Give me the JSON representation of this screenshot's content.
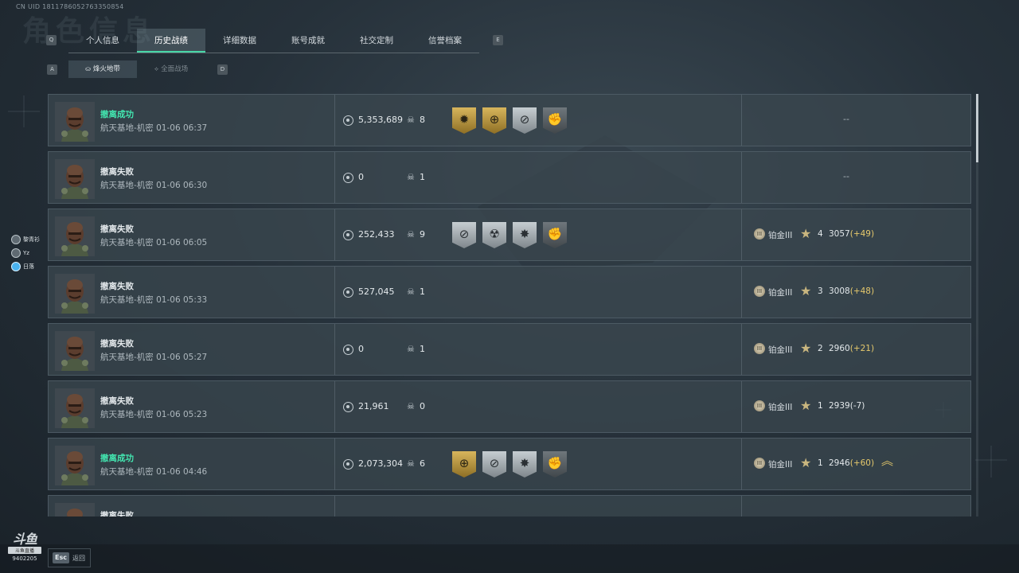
{
  "uid": "CN UID 1811786052763350854",
  "bg_title": "角色信息",
  "tab_keys": {
    "left": "Q",
    "right": "E"
  },
  "subtab_keys": {
    "left": "A",
    "right": "D"
  },
  "tabs": [
    {
      "label": "个人信息"
    },
    {
      "label": "历史战绩"
    },
    {
      "label": "详细数据"
    },
    {
      "label": "账号成就"
    },
    {
      "label": "社交定制"
    },
    {
      "label": "信誉档案"
    }
  ],
  "subtabs": [
    {
      "label": "烽火地带",
      "glyph": "⛀"
    },
    {
      "label": "全面战场",
      "glyph": "⟡"
    }
  ],
  "rows": [
    {
      "status": "撤离成功",
      "success": true,
      "map": "航天基地-机密 01-06 06:37",
      "value": "5,353,689",
      "kills": "8",
      "badges": [
        {
          "type": "gold",
          "glyph": "✹"
        },
        {
          "type": "gold",
          "glyph": "⊕"
        },
        {
          "type": "silver",
          "glyph": "⊘"
        },
        {
          "type": "dark",
          "glyph": "✊"
        }
      ],
      "rank": null,
      "dash": "--"
    },
    {
      "status": "撤离失败",
      "success": false,
      "map": "航天基地-机密 01-06 06:30",
      "value": "0",
      "kills": "1",
      "badges": [],
      "rank": null,
      "dash": "--"
    },
    {
      "status": "撤离失败",
      "success": false,
      "map": "航天基地-机密 01-06 06:05",
      "value": "252,433",
      "kills": "9",
      "badges": [
        {
          "type": "silver",
          "glyph": "⊘"
        },
        {
          "type": "silver",
          "glyph": "☢"
        },
        {
          "type": "silver",
          "glyph": "✸"
        },
        {
          "type": "dark",
          "glyph": "✊"
        }
      ],
      "rank": {
        "tier": "铂金III",
        "icon": "III",
        "stars": "4",
        "score": "3057",
        "delta": "(+49)",
        "promo": false
      }
    },
    {
      "status": "撤离失败",
      "success": false,
      "map": "航天基地-机密 01-06 05:33",
      "value": "527,045",
      "kills": "1",
      "badges": [],
      "rank": {
        "tier": "铂金III",
        "icon": "III",
        "stars": "3",
        "score": "3008",
        "delta": "(+48)",
        "promo": false
      }
    },
    {
      "status": "撤离失败",
      "success": false,
      "map": "航天基地-机密 01-06 05:27",
      "value": "0",
      "kills": "1",
      "badges": [],
      "rank": {
        "tier": "铂金III",
        "icon": "III",
        "stars": "2",
        "score": "2960",
        "delta": "(+21)",
        "promo": false
      }
    },
    {
      "status": "撤离失败",
      "success": false,
      "map": "航天基地-机密 01-06 05:23",
      "value": "21,961",
      "kills": "0",
      "badges": [],
      "rank": {
        "tier": "铂金III",
        "icon": "III",
        "stars": "1",
        "score": "2939",
        "delta": "(-7)",
        "promo": false,
        "negative": true
      }
    },
    {
      "status": "撤离成功",
      "success": true,
      "map": "航天基地-机密 01-06 04:46",
      "value": "2,073,304",
      "kills": "6",
      "badges": [
        {
          "type": "gold",
          "glyph": "⊕"
        },
        {
          "type": "silver",
          "glyph": "⊘"
        },
        {
          "type": "silver",
          "glyph": "✸"
        },
        {
          "type": "dark",
          "glyph": "✊"
        }
      ],
      "rank": {
        "tier": "铂金III",
        "icon": "III",
        "stars": "1",
        "score": "2946",
        "delta": "(+60)",
        "promo": true
      }
    },
    {
      "status": "撤离失败",
      "success": false,
      "map": "",
      "value": "",
      "kills": "",
      "badges": [],
      "rank": null,
      "dash": ""
    }
  ],
  "friends": [
    {
      "name": "黎青衫",
      "blue": false
    },
    {
      "name": "Yz",
      "blue": false
    },
    {
      "name": "日落",
      "blue": true
    }
  ],
  "footer": {
    "esc_key": "Esc",
    "esc_label": "返回"
  },
  "logo": {
    "big": "斗鱼",
    "small": "斗鱼直播",
    "room": "9402205"
  },
  "colors": {
    "accent": "#48d6a7",
    "success": "#43e6b0",
    "gold": "#e6c96c"
  },
  "icons": {
    "coin": "coin-icon",
    "skull": "skull-icon",
    "star": "star-icon",
    "rank": "rank-platinum-icon",
    "promo": "rank-up-chevrons-icon"
  }
}
